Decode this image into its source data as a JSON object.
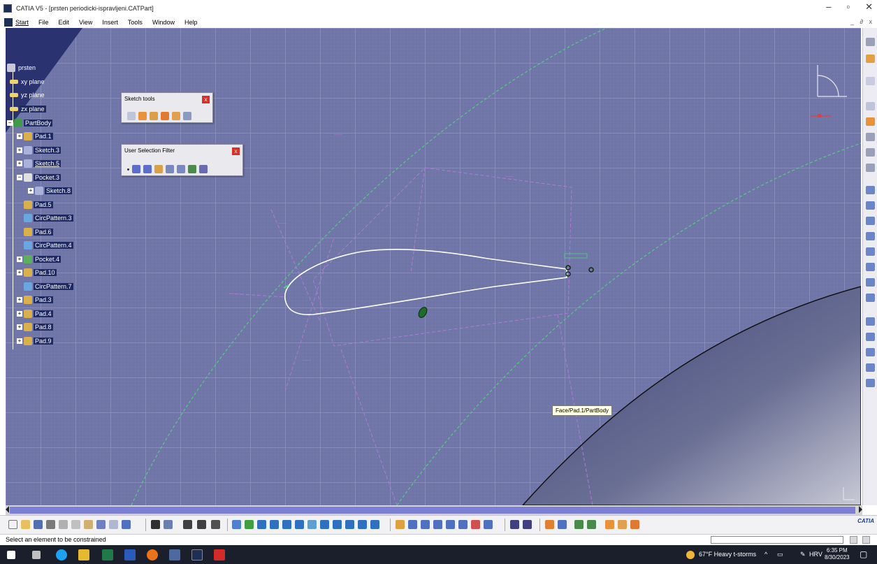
{
  "window": {
    "title": "CATIA V5 - [prsten periodicki-ispravljeni.CATPart]",
    "controls": [
      "–",
      "▫",
      "✕"
    ],
    "mdi_controls": "_ ∂ x"
  },
  "menu": {
    "items": [
      {
        "label": "Start"
      },
      {
        "label": "File"
      },
      {
        "label": "Edit"
      },
      {
        "label": "View"
      },
      {
        "label": "Insert"
      },
      {
        "label": "Tools"
      },
      {
        "label": "Window"
      },
      {
        "label": "Help"
      }
    ]
  },
  "tree": {
    "root": "prsten",
    "planes": [
      "xy plane",
      "yz plane",
      "zx plane"
    ],
    "body": "PartBody",
    "features": [
      "Pad.1",
      "Sketch.3",
      "Sketch.5",
      "Pocket.3",
      "Sketch.8",
      "Pad.5",
      "CircPattern.3",
      "Pad.6",
      "CircPattern.4",
      "Pocket.4",
      "Pad.10",
      "CircPattern.7",
      "Pad.3",
      "Pad.4",
      "Pad.8",
      "Pad.9"
    ]
  },
  "panels": {
    "sketch_tools": {
      "title": "Sketch tools",
      "close": "x"
    },
    "selection_filter": {
      "title": "User Selection Filter",
      "close": "x"
    }
  },
  "tooltip": "Face/Pad.1/PartBody",
  "status": {
    "message": "Select an element to be constrained"
  },
  "bottom_logo": "CATIA",
  "taskbar": {
    "weather": "67°F  Heavy t-storms",
    "lang": "HRV",
    "time": "6:35 PM",
    "date": "8/30/2023"
  },
  "colors": {
    "viewport_bg": "#6f75a6",
    "tree_highlight": "#1f2a63",
    "profile": "#ffffff",
    "construction": "#b07ad9",
    "circle_guides": "#4fd17a"
  }
}
